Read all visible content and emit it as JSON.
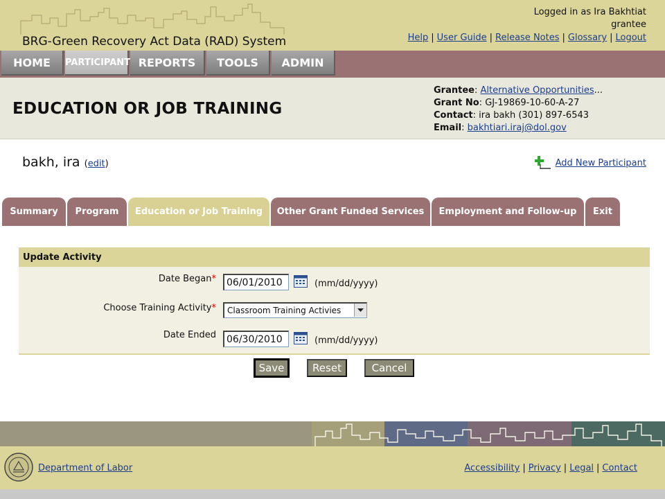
{
  "header": {
    "app_title": "BRG-Green Recovery Act Data (RAD) System",
    "logged_in_text": "Logged in as Ira Bakhtiat",
    "role": "grantee",
    "links": [
      "Help",
      "User Guide",
      "Release Notes",
      "Glossary",
      "Logout"
    ]
  },
  "nav": {
    "items": [
      "HOME",
      "PARTICIPANTS",
      "REPORTS",
      "TOOLS",
      "ADMIN"
    ],
    "active": "PARTICIPANTS"
  },
  "page": {
    "title": "EDUCATION OR JOB TRAINING"
  },
  "grant_info": {
    "grantee_label": "Grantee",
    "grantee_value": "Alternative Opportunities",
    "grantee_ellipsis": "...",
    "grant_no_label": "Grant No",
    "grant_no_value": "GJ-19869-10-60-A-27",
    "contact_label": "Contact",
    "contact_value": "ira bakh (301) 897-6543",
    "email_label": "Email",
    "email_value": "bakhtiari.iraj@dol.gov"
  },
  "participant": {
    "name": "bakh, ira",
    "edit_open": "(",
    "edit_label": "edit",
    "edit_close": ")",
    "add_new_label": "Add New Participant"
  },
  "tabs": {
    "items": [
      "Summary",
      "Program",
      "Education or Job Training",
      "Other Grant Funded Services",
      "Employment and Follow-up",
      "Exit"
    ],
    "active": "Education or Job Training"
  },
  "form": {
    "section_title": "Update Activity",
    "date_began_label": "Date Began",
    "date_began_value": "06/01/2010",
    "training_activity_label": "Choose Training Activity",
    "training_activity_value": "Classroom Training Activies",
    "date_ended_label": "Date Ended",
    "date_ended_value": "06/30/2010",
    "date_format_hint": "(mm/dd/yyyy)",
    "required_marker": "*",
    "save_label": "Save",
    "reset_label": "Reset",
    "cancel_label": "Cancel"
  },
  "footer": {
    "dol_link": "Department of Labor",
    "links": [
      "Accessibility",
      "Privacy",
      "Legal",
      "Contact"
    ]
  },
  "colors": {
    "header_bg": "#dcd59a",
    "nav_bg": "#9b7273",
    "tab_bg": "#9b7273",
    "tab_active_bg": "#d8d193",
    "link": "#1b3d8f",
    "required": "#dd0000"
  },
  "icons": {
    "calendar": "calendar-icon",
    "add_participant": "add-person-icon",
    "seal": "dol-seal-icon"
  }
}
